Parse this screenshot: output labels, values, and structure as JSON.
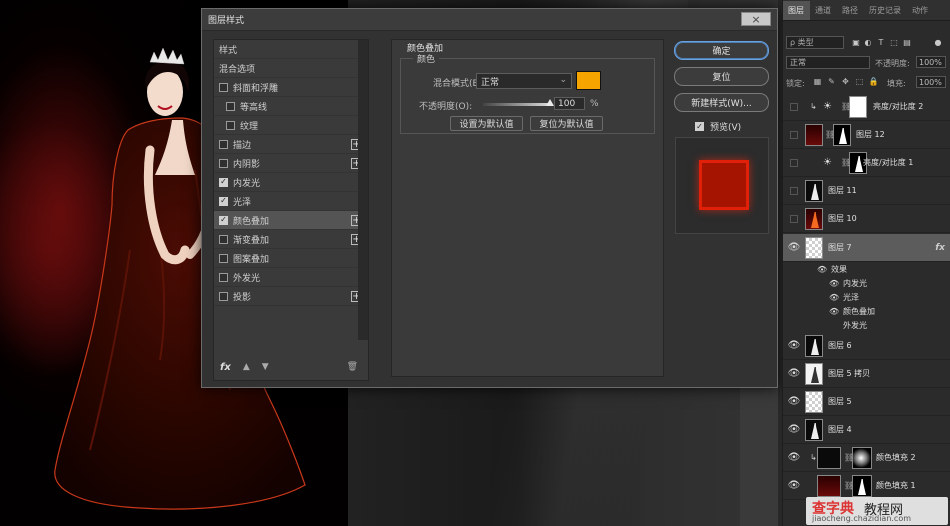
{
  "dialog": {
    "title": "图层样式",
    "close_icon": "×",
    "style_list": [
      {
        "label": "样式",
        "checkbox": false,
        "checked": false,
        "plus": false,
        "sub": false
      },
      {
        "label": "混合选项",
        "checkbox": false,
        "checked": false,
        "plus": false,
        "sub": false
      },
      {
        "label": "斜面和浮雕",
        "checkbox": true,
        "checked": false,
        "plus": false,
        "sub": false
      },
      {
        "label": "等高线",
        "checkbox": true,
        "checked": false,
        "plus": false,
        "sub": true
      },
      {
        "label": "纹理",
        "checkbox": true,
        "checked": false,
        "plus": false,
        "sub": true
      },
      {
        "label": "描边",
        "checkbox": true,
        "checked": false,
        "plus": true,
        "sub": false
      },
      {
        "label": "内阴影",
        "checkbox": true,
        "checked": false,
        "plus": true,
        "sub": false
      },
      {
        "label": "内发光",
        "checkbox": true,
        "checked": true,
        "plus": false,
        "sub": false
      },
      {
        "label": "光泽",
        "checkbox": true,
        "checked": true,
        "plus": false,
        "sub": false
      },
      {
        "label": "颜色叠加",
        "checkbox": true,
        "checked": true,
        "plus": true,
        "sub": false
      },
      {
        "label": "渐变叠加",
        "checkbox": true,
        "checked": false,
        "plus": true,
        "sub": false
      },
      {
        "label": "图案叠加",
        "checkbox": true,
        "checked": false,
        "plus": false,
        "sub": false
      },
      {
        "label": "外发光",
        "checkbox": true,
        "checked": false,
        "plus": false,
        "sub": false
      },
      {
        "label": "投影",
        "checkbox": true,
        "checked": false,
        "plus": true,
        "sub": false
      }
    ],
    "selected_index": 9,
    "footer": {
      "fx_label": "fx",
      "up_icon": "▲",
      "down_icon": "▼",
      "trash_icon": "🗑"
    },
    "section_title": "颜色叠加",
    "group_title": "颜色",
    "blend_label": "混合模式(B):",
    "blend_value": "正常",
    "overlay_color": "#f5a400",
    "opacity_label": "不透明度(O):",
    "opacity_value": "100",
    "opacity_unit": "%",
    "opacity_fraction": 1.0,
    "btn_set_default": "设置为默认值",
    "btn_reset_default": "复位为默认值",
    "btn_ok": "确定",
    "btn_reset": "复位",
    "btn_new_style": "新建样式(W)...",
    "preview_label": "预览(V)",
    "preview_checked": true
  },
  "panel": {
    "tabs": [
      "图层",
      "通道",
      "路径",
      "历史记录",
      "动作"
    ],
    "active_tab": 0,
    "filter_label": "ρ 类型",
    "mode_value": "正常",
    "opacity_label": "不透明度:",
    "opacity_value": "100%",
    "lock_label": "锁定:",
    "fill_label": "填充:",
    "fill_value": "100%",
    "layers": [
      {
        "name": "亮度/对比度 2",
        "eye": false,
        "clip": true
      },
      {
        "name": "图层 12",
        "eye": false,
        "clip": false
      },
      {
        "name": "亮度/对比度 1",
        "eye": false,
        "clip": false
      },
      {
        "name": "图层 11",
        "eye": false,
        "clip": false
      },
      {
        "name": "图层 10",
        "eye": false,
        "clip": false
      },
      {
        "name": "图层 7",
        "eye": true,
        "clip": false,
        "fx": "fx"
      },
      {
        "name": "图层 6",
        "eye": true,
        "clip": false
      },
      {
        "name": "图层 5 拷贝",
        "eye": true,
        "clip": false
      },
      {
        "name": "图层 5",
        "eye": true,
        "clip": false
      },
      {
        "name": "图层 4",
        "eye": true,
        "clip": false
      },
      {
        "name": "颜色填充 2",
        "eye": true,
        "clip": true
      },
      {
        "name": "颜色填充 1",
        "eye": true,
        "clip": false
      }
    ],
    "effects": {
      "header": "效果",
      "items": [
        "内发光",
        "光泽",
        "颜色叠加",
        "外发光"
      ],
      "visible": [
        true,
        true,
        true,
        false
      ]
    }
  },
  "watermark": {
    "line1": "查字典",
    "line2": "教程网",
    "line3": "jiaocheng.chazidian.com"
  }
}
